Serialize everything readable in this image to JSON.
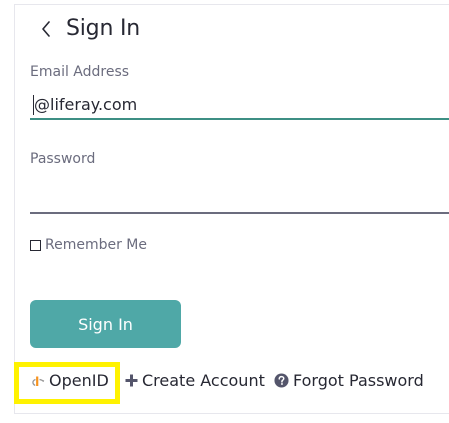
{
  "header": {
    "title": "Sign In"
  },
  "form": {
    "email_label": "Email Address",
    "email_value": "@liferay.com",
    "password_label": "Password",
    "password_value": "",
    "remember_label": "Remember Me",
    "remember_checked": false,
    "submit_label": "Sign In"
  },
  "links": {
    "openid": "OpenID",
    "create_account": "Create Account",
    "forgot_password": "Forgot Password"
  },
  "icons": {
    "back": "chevron-left-icon",
    "openid": "openid-icon",
    "create_account": "plus-icon",
    "forgot_password": "question-circle-icon"
  },
  "colors": {
    "accent": "#4fa8a7",
    "email_underline": "#3d8f84",
    "highlight": "#fff200",
    "text": "#272833",
    "secondary_text": "#6b6c7e"
  }
}
